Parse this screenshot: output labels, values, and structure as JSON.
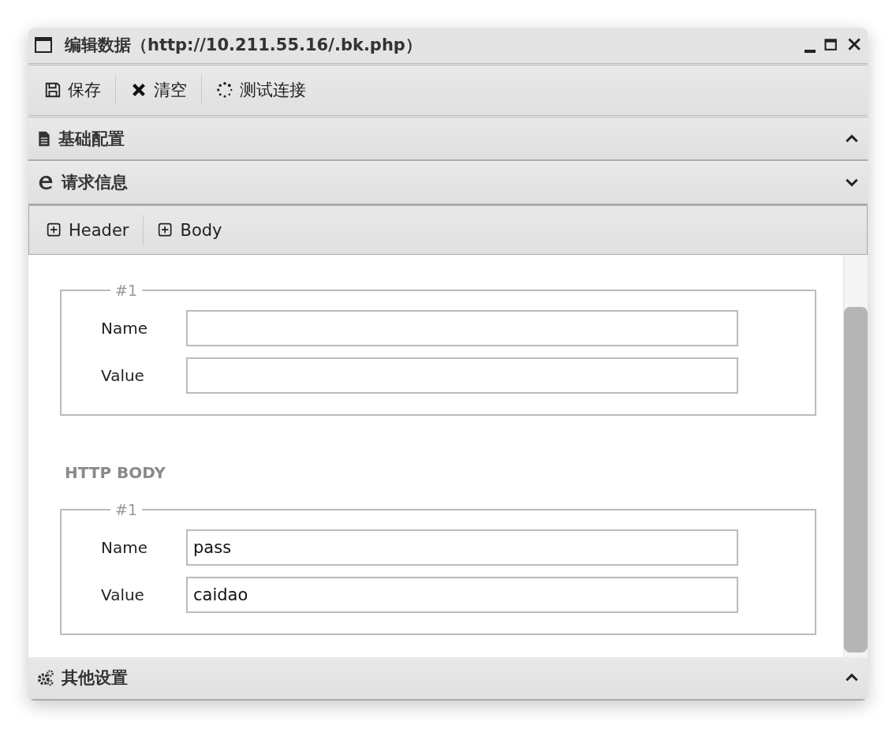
{
  "window": {
    "title": "编辑数据（http://10.211.55.16/.bk.php）"
  },
  "toolbar": [
    {
      "kind": "save",
      "label": "保存"
    },
    {
      "kind": "clear",
      "label": "清空"
    },
    {
      "kind": "test",
      "label": "测试连接"
    }
  ],
  "panels_top": [
    {
      "kind": "doc",
      "label": "基础配置",
      "expanded": false
    },
    {
      "kind": "edge",
      "label": "请求信息",
      "expanded": true
    }
  ],
  "sub_toolbar": [
    {
      "label": "Header"
    },
    {
      "label": "Body"
    }
  ],
  "sections": [
    {
      "groups": [
        {
          "legend": "#1",
          "fields": [
            {
              "label": "Name"
            },
            {
              "label": "Value"
            }
          ]
        }
      ]
    },
    {
      "heading": "HTTP BODY",
      "groups": [
        {
          "legend": "#1",
          "fields": [
            {
              "label": "Name",
              "value": "pass"
            },
            {
              "label": "Value",
              "value": "caidao"
            }
          ]
        }
      ]
    }
  ],
  "panels_bottom": [
    {
      "kind": "gears",
      "label": "其他设置",
      "expanded": false
    }
  ]
}
